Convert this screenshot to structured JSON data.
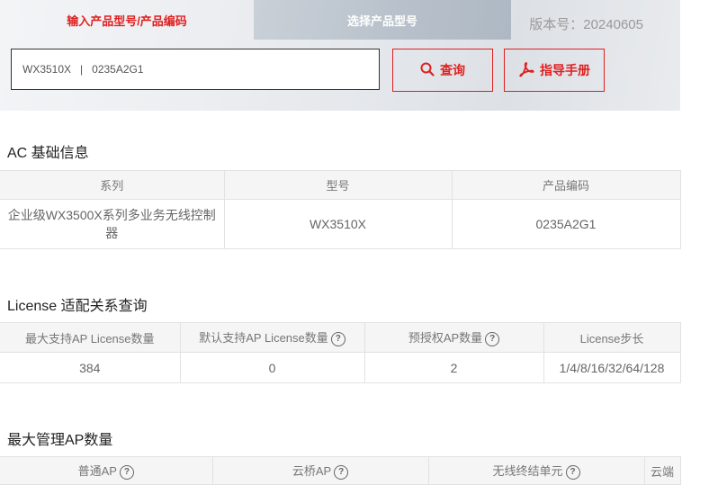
{
  "header": {
    "tab_input": "输入产品型号/产品编码",
    "tab_select": "选择产品型号",
    "version": "版本号：20240605",
    "search_value": "WX3510X   |   0235A2G1",
    "query_label": "查询",
    "manual_label": "指导手册",
    "accent": "#e02020"
  },
  "ac_info": {
    "title": "AC 基础信息",
    "headers": [
      "系列",
      "型号",
      "产品编码"
    ],
    "row": [
      "企业级WX3500X系列多业务无线控制器",
      "WX3510X",
      "0235A2G1"
    ]
  },
  "license": {
    "title": "License 适配关系查询",
    "headers": [
      "最大支持AP License数量",
      "默认支持AP License数量",
      "预授权AP数量",
      "License步长"
    ],
    "row": [
      "384",
      "0",
      "2",
      "1/4/8/16/32/64/128"
    ]
  },
  "max_ap": {
    "title": "最大管理AP数量",
    "headers": [
      "普通AP",
      "云桥AP",
      "无线终结单元",
      "云端"
    ]
  }
}
